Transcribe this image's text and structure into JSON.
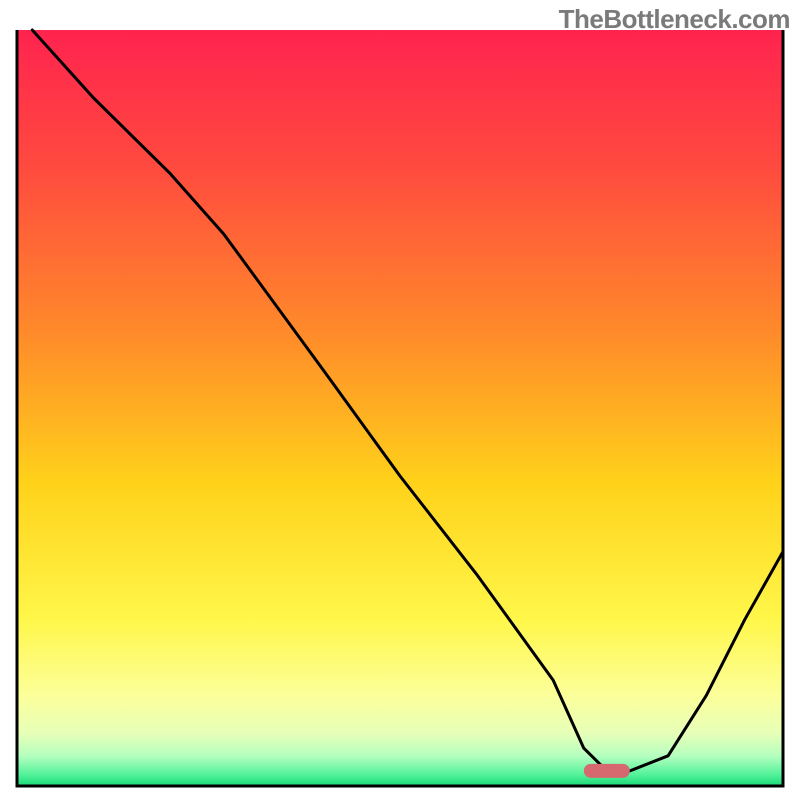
{
  "watermark": "TheBottleneck.com",
  "chart_data": {
    "type": "line",
    "title": "",
    "xlabel": "",
    "ylabel": "",
    "xlim": [
      0,
      100
    ],
    "ylim": [
      0,
      100
    ],
    "x": [
      2,
      10,
      20,
      27,
      40,
      50,
      60,
      70,
      74,
      77,
      80,
      85,
      90,
      95,
      100
    ],
    "values": [
      100,
      91,
      81,
      73,
      55,
      41,
      28,
      14,
      5,
      2,
      2,
      4,
      12,
      22,
      31
    ],
    "marker": {
      "x": 77,
      "y": 2,
      "color": "#d6696f"
    },
    "gradient_stops": [
      {
        "offset": 0.0,
        "color": "#ff234f"
      },
      {
        "offset": 0.18,
        "color": "#ff4a3f"
      },
      {
        "offset": 0.4,
        "color": "#ff8a2a"
      },
      {
        "offset": 0.6,
        "color": "#ffd21a"
      },
      {
        "offset": 0.78,
        "color": "#fff74a"
      },
      {
        "offset": 0.88,
        "color": "#fcff9a"
      },
      {
        "offset": 0.93,
        "color": "#e7ffb8"
      },
      {
        "offset": 0.96,
        "color": "#b5ffbf"
      },
      {
        "offset": 0.985,
        "color": "#53f29a"
      },
      {
        "offset": 1.0,
        "color": "#17d977"
      }
    ]
  }
}
